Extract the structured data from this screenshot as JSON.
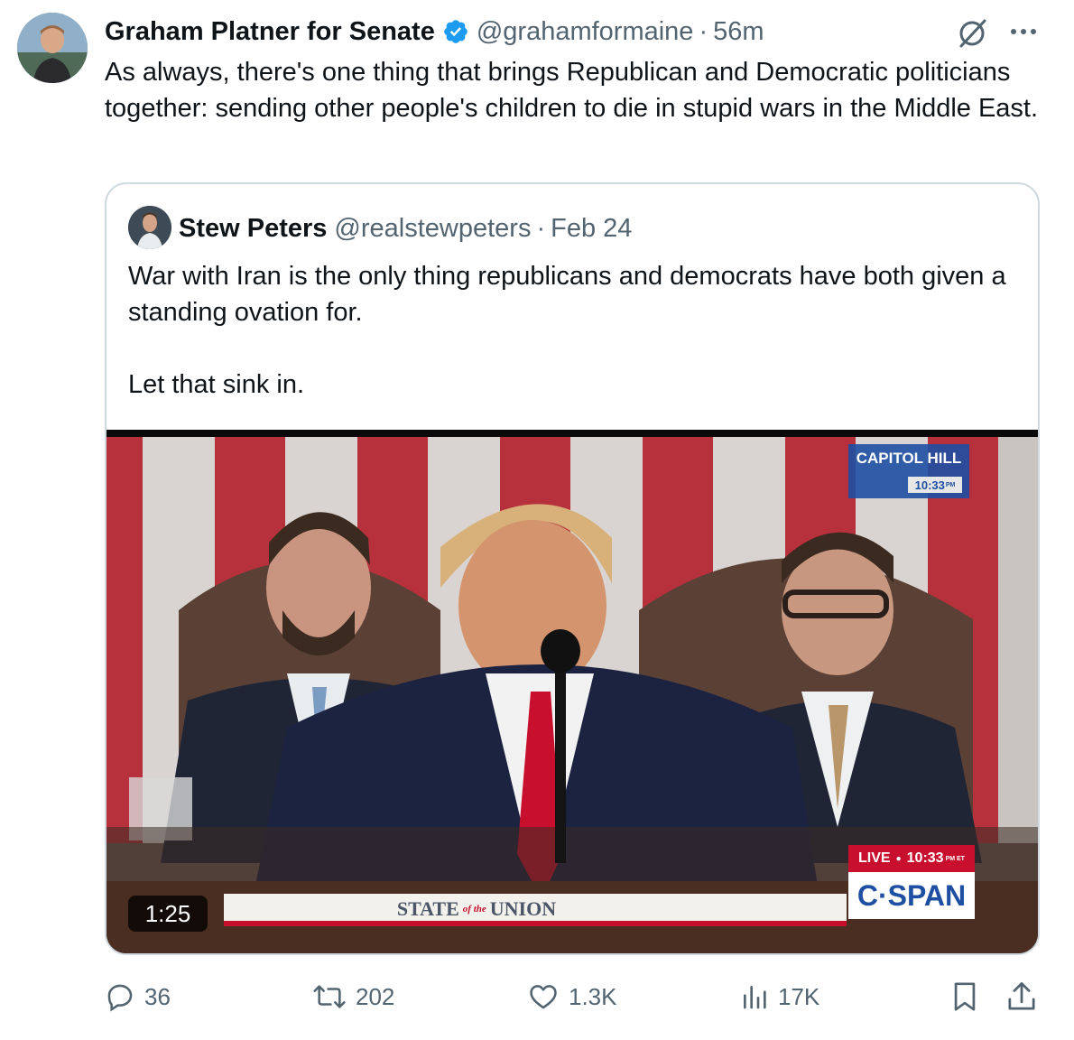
{
  "post": {
    "author_name": "Graham Platner for Senate",
    "handle": "@grahamformaine",
    "separator": "·",
    "time": "56m",
    "text": "As always, there's one thing that brings Republican and Democratic politicians together: sending other people's children to die in stupid wars in the Middle East."
  },
  "quoted": {
    "author_name": "Stew Peters",
    "handle": "@realstewpeters",
    "separator": "·",
    "date": "Feb 24",
    "text_line1": "War with Iran is the only thing republicans and democrats have both given a standing ovation for.",
    "text_line2": "Let that sink in.",
    "video": {
      "duration": "1:25",
      "overlay_location": "CAPITOL HILL",
      "overlay_time": "10:33",
      "overlay_ampm": "PM",
      "live_label": "LIVE",
      "live_time": "10:33",
      "live_ampm": "PM ET",
      "network": "C·SPAN",
      "banner_left": "STATE",
      "banner_mid": "of the",
      "banner_right": "UNION"
    }
  },
  "actions": {
    "replies": "36",
    "reposts": "202",
    "likes": "1.3K",
    "views": "17K"
  },
  "icons": {
    "verified": "verified-badge-icon",
    "grok": "grok-icon",
    "more": "more-icon",
    "reply": "reply-icon",
    "repost": "repost-icon",
    "like": "like-icon",
    "views": "views-icon",
    "bookmark": "bookmark-icon",
    "share": "share-icon"
  },
  "colors": {
    "accent": "#1d9bf0",
    "muted": "#536471",
    "border": "#cfd9de",
    "cspan_blue": "#1e4fa3",
    "tie_red": "#c8102e"
  }
}
